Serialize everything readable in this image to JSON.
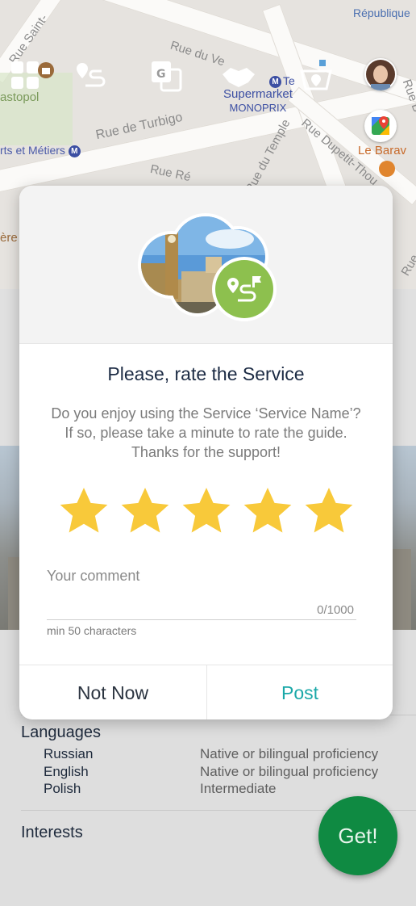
{
  "map": {
    "labels": {
      "republique": "République",
      "rue_saint": "Rue Saint-",
      "rue_du_vert": "Rue du Ve",
      "rue_de_turbigo": "Rue de Turbigo",
      "rue_re": "Rue Ré",
      "sebastopol": "astopol",
      "arts_et_metiers": "rts et Métiers",
      "rue_du_temple": "Rue du Temple",
      "rue_dupetit_thouars": "Rue Dupetit-Thou",
      "supermarket": "Supermarket",
      "monoprix": "MONOPRIX",
      "le_barav": "Le Barav",
      "te": "Te",
      "rue_b": "Rue B",
      "ere": "ère",
      "rue": "Rue",
      "metro_glyph": "M"
    },
    "toolbar_icons": [
      "grid-icon",
      "route-icon",
      "translate-icon",
      "handshake-icon",
      "basket-icon"
    ]
  },
  "profile": {
    "languages_title": "Languages",
    "languages": [
      {
        "name": "Russian",
        "level": "Native or bilingual proficiency"
      },
      {
        "name": "English",
        "level": "Native or bilingual proficiency"
      },
      {
        "name": "Polish",
        "level": "Intermediate"
      }
    ],
    "interests_title": "Interests",
    "get_button": "Get!"
  },
  "dialog": {
    "title": "Please, rate the Service",
    "message_lines": [
      "Do you enjoy using the Service ‘Service Name’?",
      "If so, please take a minute to rate the guide.",
      "Thanks for the support!"
    ],
    "rating": 5,
    "max_rating": 5,
    "comment_placeholder": "Your comment",
    "comment_counter": "0/1000",
    "comment_hint": "min 50 characters",
    "not_now_label": "Not Now",
    "post_label": "Post",
    "colors": {
      "star": "#f8c93a",
      "post": "#1aa8a8",
      "badge": "#8dc04e",
      "get_button": "#0f8a42"
    }
  }
}
